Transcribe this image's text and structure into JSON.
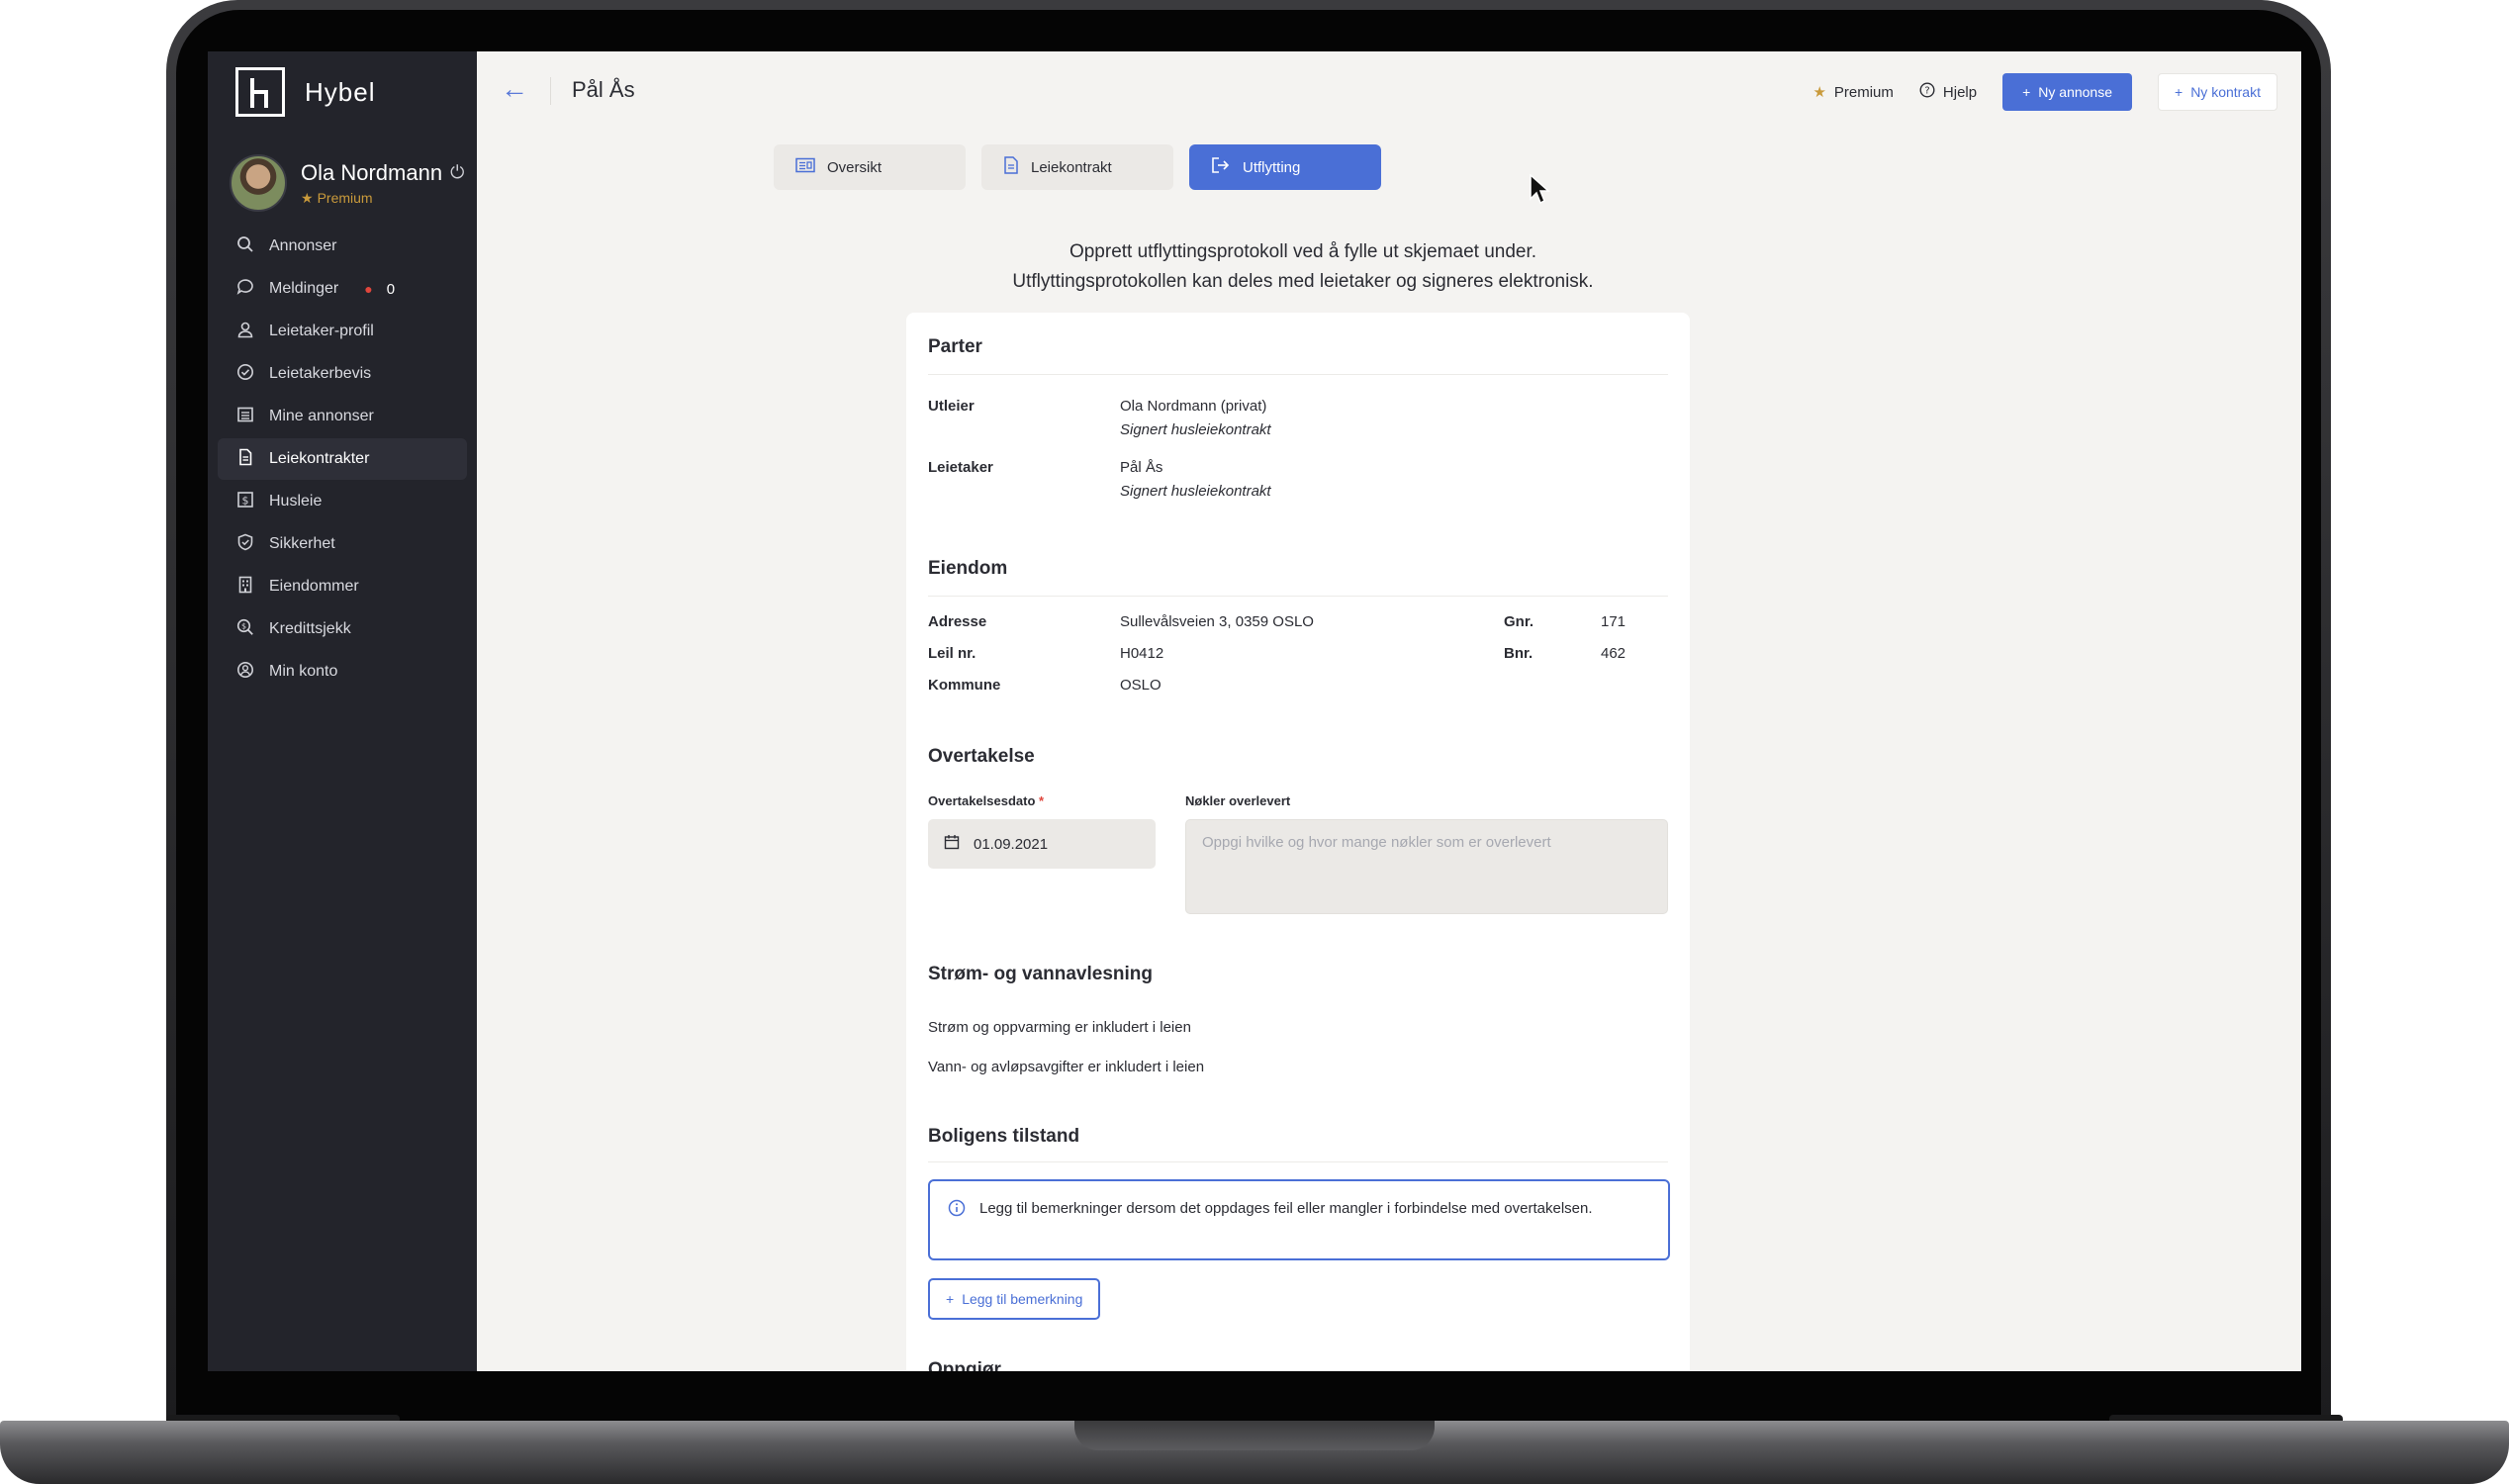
{
  "app": {
    "name": "Hybel"
  },
  "user": {
    "name": "Ola Nordmann",
    "tier": "Premium"
  },
  "sidebar": {
    "items": [
      {
        "label": "Annonser",
        "icon": "search-icon"
      },
      {
        "label": "Meldinger",
        "icon": "chat-icon",
        "badge": "0"
      },
      {
        "label": "Leietaker-profil",
        "icon": "user-icon"
      },
      {
        "label": "Leietakerbevis",
        "icon": "check-circle-icon"
      },
      {
        "label": "Mine annonser",
        "icon": "list-icon"
      },
      {
        "label": "Leiekontrakter",
        "icon": "document-icon",
        "active": true
      },
      {
        "label": "Husleie",
        "icon": "dollar-icon"
      },
      {
        "label": "Sikkerhet",
        "icon": "shield-icon"
      },
      {
        "label": "Eiendommer",
        "icon": "building-icon"
      },
      {
        "label": "Kredittsjekk",
        "icon": "search-dollar-icon"
      },
      {
        "label": "Min konto",
        "icon": "account-icon"
      }
    ]
  },
  "header": {
    "title": "Pål Ås",
    "premium": "Premium",
    "help": "Hjelp",
    "new_ad": "Ny annonse",
    "new_contract": "Ny kontrakt"
  },
  "tabs": [
    {
      "label": "Oversikt",
      "icon": "overview-icon"
    },
    {
      "label": "Leiekontrakt",
      "icon": "document-icon"
    },
    {
      "label": "Utflytting",
      "icon": "exit-icon",
      "active": true
    }
  ],
  "intro": {
    "line1": "Opprett utflyttingsprotokoll ved å fylle ut skjemaet under.",
    "line2": "Utflyttingsprotokollen kan deles med leietaker og signeres elektronisk."
  },
  "form": {
    "parter": {
      "title": "Parter",
      "utleier_label": "Utleier",
      "utleier_name": "Ola Nordmann (privat)",
      "utleier_status": "Signert husleiekontrakt",
      "leietaker_label": "Leietaker",
      "leietaker_name": "Pål Ås",
      "leietaker_status": "Signert husleiekontrakt"
    },
    "eiendom": {
      "title": "Eiendom",
      "adresse_label": "Adresse",
      "adresse": "Sullevålsveien 3, 0359 OSLO",
      "leil_label": "Leil nr.",
      "leil": "H0412",
      "kommune_label": "Kommune",
      "kommune": "OSLO",
      "gnr_label": "Gnr.",
      "gnr": "171",
      "bnr_label": "Bnr.",
      "bnr": "462"
    },
    "overtakelse": {
      "title": "Overtakelse",
      "date_label": "Overtakelsesdato",
      "date_value": "01.09.2021",
      "keys_label": "Nøkler overlevert",
      "keys_placeholder": "Oppgi hvilke og hvor mange nøkler som er overlevert"
    },
    "strom": {
      "title": "Strøm- og vannavlesning",
      "line1": "Strøm og oppvarming er inkludert i leien",
      "line2": "Vann- og avløpsavgifter er inkludert i leien"
    },
    "tilstand": {
      "title": "Boligens tilstand",
      "info": "Legg til bemerkninger dersom det oppdages feil eller mangler i forbindelse med overtakelsen.",
      "add_button": "Legg til bemerkning"
    },
    "next_section": "Oppgjør"
  },
  "colors": {
    "accent": "#4a6fd6",
    "sidebar_bg": "#23242b",
    "premium": "#c99a3b"
  }
}
